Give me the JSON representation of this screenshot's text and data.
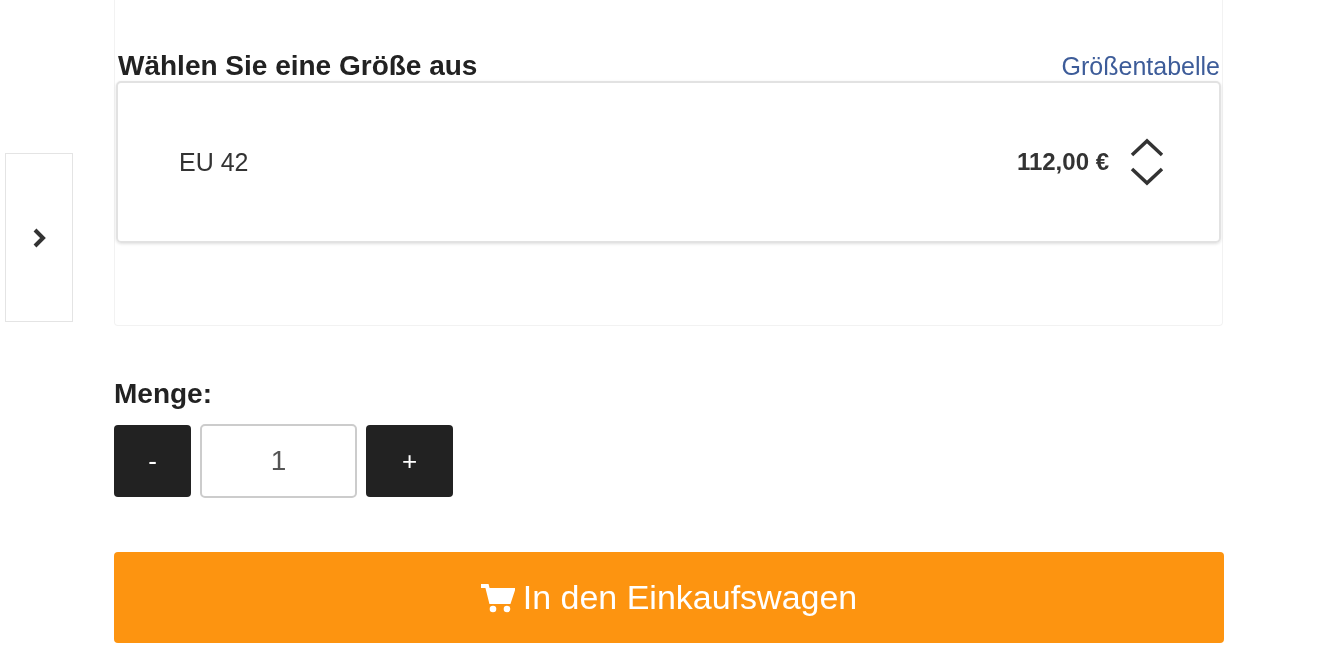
{
  "size_section": {
    "title": "Wählen Sie eine Größe aus",
    "size_chart_link": "Größentabelle",
    "size_select": {
      "value": "EU 42",
      "price": "112,00 €"
    }
  },
  "quantity": {
    "label": "Menge:",
    "decrement": "-",
    "value": "1",
    "increment": "+"
  },
  "add_to_cart": {
    "label": "In den Einkaufswagen"
  }
}
